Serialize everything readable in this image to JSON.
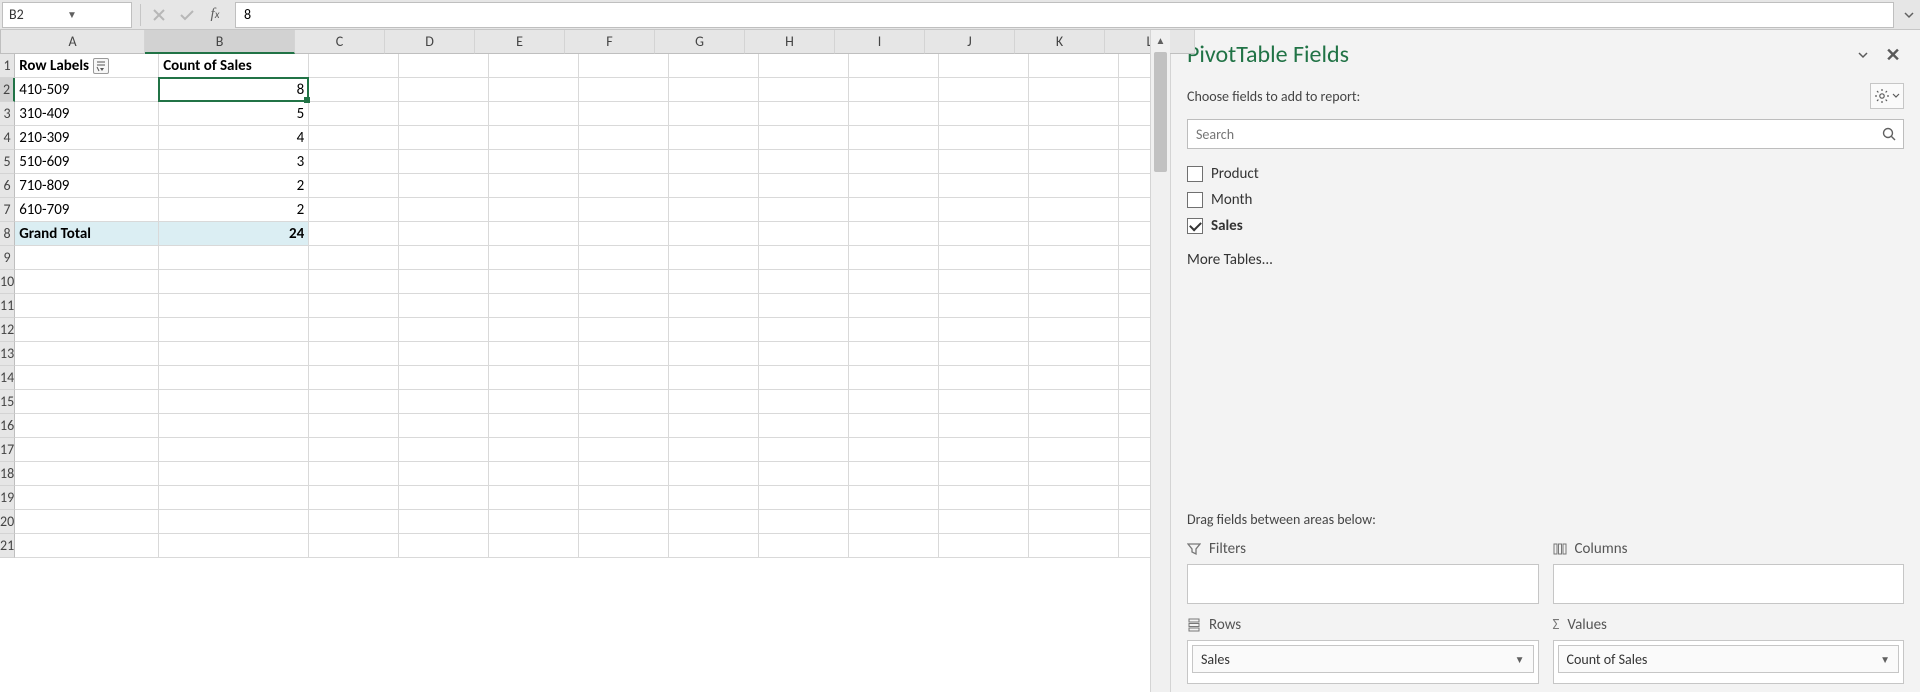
{
  "namebox": "B2",
  "formula": "8",
  "columns": [
    "A",
    "B",
    "C",
    "D",
    "E",
    "F",
    "G",
    "H",
    "I",
    "J",
    "K",
    "L"
  ],
  "selectedCol": "B",
  "selectedRow": 2,
  "rows": [
    1,
    2,
    3,
    4,
    5,
    6,
    7,
    8,
    9,
    10,
    11,
    12,
    13,
    14,
    15,
    16,
    17,
    18,
    19,
    20,
    21
  ],
  "pivot": {
    "headerA": "Row Labels",
    "headerB": "Count of Sales",
    "data": [
      {
        "label": "410-509",
        "count": 8
      },
      {
        "label": "310-409",
        "count": 5
      },
      {
        "label": "210-309",
        "count": 4
      },
      {
        "label": "510-609",
        "count": 3
      },
      {
        "label": "710-809",
        "count": 2
      },
      {
        "label": "610-709",
        "count": 2
      }
    ],
    "totalLabel": "Grand Total",
    "totalValue": 24
  },
  "pane": {
    "title": "PivotTable Fields",
    "subtitle": "Choose fields to add to report:",
    "searchPlaceholder": "Search",
    "fields": [
      {
        "name": "Product",
        "checked": false,
        "bold": false
      },
      {
        "name": "Month",
        "checked": false,
        "bold": false
      },
      {
        "name": "Sales",
        "checked": true,
        "bold": true
      }
    ],
    "moreTables": "More Tables...",
    "dragLabel": "Drag fields between areas below:",
    "areas": {
      "filters": "Filters",
      "columns": "Columns",
      "rows": "Rows",
      "values": "Values",
      "rowsPill": "Sales",
      "valuesPill": "Count of Sales"
    }
  }
}
